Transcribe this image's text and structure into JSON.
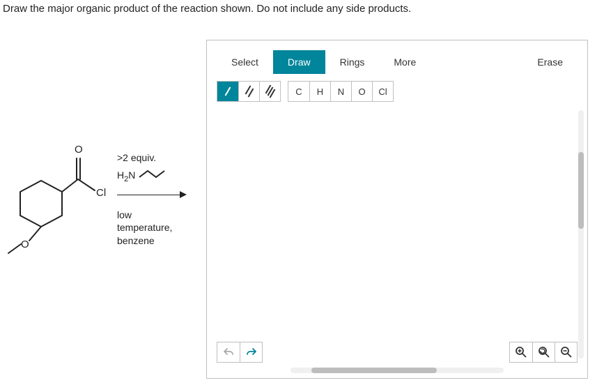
{
  "question": {
    "text": "Draw the major organic product of the reaction shown. Do not include any side products."
  },
  "reagents": {
    "equiv": ">2 equiv.",
    "amine_prefix": "H",
    "amine_sub": "2",
    "amine_suffix": "N",
    "conditions_line1": "low",
    "conditions_line2": "temperature,",
    "conditions_line3": "benzene"
  },
  "molecule": {
    "substituent_top": "O",
    "substituent_right": "Cl",
    "substituent_bottom_left": "O"
  },
  "editor": {
    "tabs": {
      "select": "Select",
      "draw": "Draw",
      "rings": "Rings",
      "more": "More",
      "erase": "Erase"
    },
    "active_tab": "draw",
    "bond_tools": {
      "single": "single-bond-icon",
      "double": "double-bond-icon",
      "triple": "triple-bond-icon"
    },
    "active_bond": "single",
    "elements": [
      "C",
      "H",
      "N",
      "O",
      "Cl"
    ],
    "bottom_tools": {
      "undo": "undo-icon",
      "redo": "redo-icon",
      "zoom_in": "zoom-in-icon",
      "zoom_reset": "zoom-reset-icon",
      "zoom_out": "zoom-out-icon"
    }
  }
}
